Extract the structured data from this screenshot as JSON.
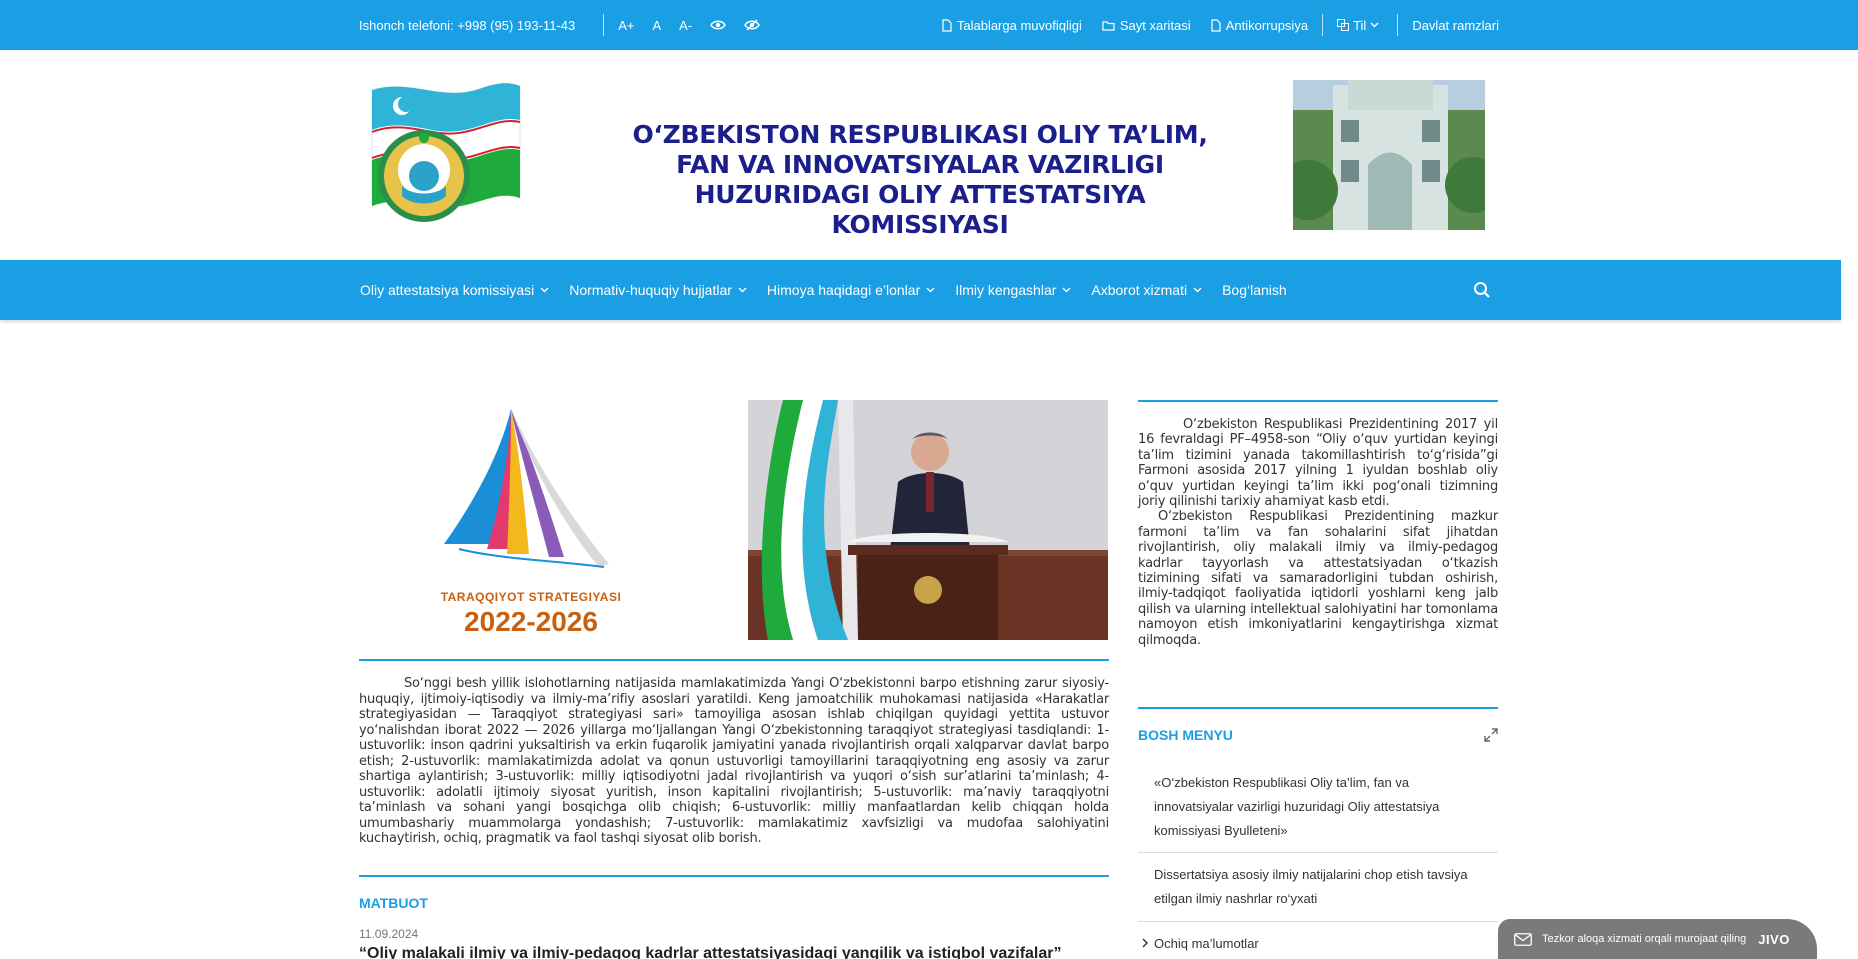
{
  "topbar": {
    "phone": "Ishonch telefoni: +998 (95) 193-11-43",
    "font_increase": "A+",
    "font_normal": "A",
    "font_decrease": "A-",
    "links": {
      "requirements": "Talablarga muvofiqligi",
      "sitemap": "Sayt xaritasi",
      "anticorruption": "Antikorrupsiya"
    },
    "language": "Til",
    "state_symbols": "Davlat ramzlari"
  },
  "header": {
    "title": "O‘ZBEKISTON RESPUBLIKASI OLIY TA’LIM, FAN VA INNOVATSIYALAR VAZIRLIGI HUZURIDAGI OLIY ATTESTATSIYA KOMISSIYASI"
  },
  "nav": {
    "items": [
      {
        "label": "Oliy attestatsiya komissiyasi"
      },
      {
        "label": "Normativ-huquqiy hujjatlar"
      },
      {
        "label": "Himoya haqidagi e’lonlar"
      },
      {
        "label": "Ilmiy kengashlar"
      },
      {
        "label": "Axborot xizmati"
      },
      {
        "label": "Bog‘lanish"
      }
    ]
  },
  "banner": {
    "caption": "TARAQQIYOT STRATEGIYASI",
    "years": "2022-2026"
  },
  "main": {
    "intro": "So‘nggi besh yillik islohotlarning natijasida mamlakatimizda Yangi O‘zbekistonni barpo etishning zarur siyosiy-huquqiy, ijtimoiy-iqtisodiy va ilmiy-ma’rifiy asoslari yaratildi. Keng jamoatchilik muhokamasi natijasida «Harakatlar strategiyasidan — Taraqqiyot strategiyasi sari» tamoyiliga asosan ishlab chiqilgan quyidagi yettita ustuvor yo‘nalishdan iborat 2022 — 2026 yillarga mo‘ljallangan Yangi O‘zbekistonning taraqqiyot strategiyasi tasdiqlandi: 1-ustuvorlik: inson qadrini yuksaltirish va erkin fuqarolik jamiyatini yanada rivojlantirish orqali xalqparvar davlat barpo etish; 2-ustuvorlik: mamlakatimizda adolat va qonun ustuvorligi tamoyillarini taraqqiyotning eng asosiy va zarur shartiga aylantirish; 3-ustuvorlik: milliy iqtisodiyotni jadal rivojlantirish va yuqori o‘sish sur’atlarini ta’minlash; 4-ustuvorlik: adolatli ijtimoiy siyosat yuritish, inson kapitalini rivojlantirish; 5-ustuvorlik: ma’naviy taraqqiyotni ta’minlash va sohani yangi bosqichga olib chiqish; 6-ustuvorlik: milliy manfaatlardan kelib chiqqan holda umumbashariy muammolarga yondashish; 7-ustuvorlik: mamlakatimiz xavfsizligi va mudofaa salohiyatini kuchaytirish, ochiq, pragmatik va faol tashqi siyosat olib borish.",
    "press_title": "MATBUOT",
    "news": {
      "date": "11.09.2024",
      "title": "“Oliy malakali ilmiy va ilmiy-pedagog kadrlar attestatsiyasidagi yangilik va istiqbol vazifalar”"
    }
  },
  "sidebar": {
    "paragraphs": [
      "O‘zbekiston Respublikasi Prezidentining 2017 yil 16 fevraldagi PF–4958-son “Oliy o‘quv yurtidan keyingi ta’lim tizimini yanada takomillashtirish to‘g‘risida”gi Farmoni asosida 2017 yilning 1 iyuldan boshlab oliy o‘quv yurtidan keyingi ta’lim ikki pog‘onali tizimning joriy qilinishi tarixiy ahamiyat kasb etdi.",
      "O‘zbekiston Respublikasi Prezidentining mazkur farmoni ta’lim va fan sohalarini sifat jihatdan rivojlantirish, oliy malakali ilmiy va ilmiy-pedagog kadrlar tayyorlash va attestatsiyadan o‘tkazish tizimining sifati va samaradorligini tubdan oshirish, ilmiy-tadqiqot faoliyatida iqtidorli yoshlarni keng jalb qilish va ularning intellektual salohiyatini har tomonlama namoyon etish imkoniyatlarini kengaytirishga xizmat qilmoqda."
    ],
    "menu_title": "BOSH MENYU",
    "menu_items": [
      "«O‘zbekiston Respublikasi Oliy ta’lim, fan va innovatsiyalar vazirligi huzuridagi Oliy attestatsiya komissiyasi Byulleteni»",
      "Dissertatsiya asosiy ilmiy natijalarini chop etish tavsiya etilgan ilmiy nashrlar ro‘yxati",
      "Ochiq ma’lumotlar"
    ]
  },
  "chat": {
    "text": "Tezkor aloqa xizmati orqali murojaat qiling",
    "brand": "JIVO"
  },
  "colors": {
    "primary": "#1a9ee4",
    "title": "#1a1f8c",
    "banner_orange": "#c8600f"
  }
}
